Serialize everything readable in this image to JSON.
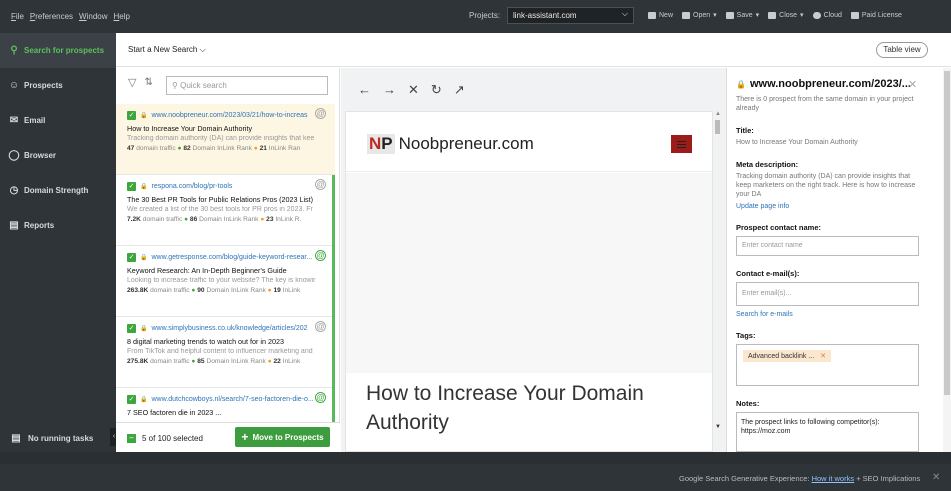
{
  "menubar": {
    "items": [
      "File",
      "Preferences",
      "Window",
      "Help"
    ],
    "accel": [
      "F",
      "P",
      "W",
      "H"
    ]
  },
  "projects": {
    "label": "Projects:",
    "selected": "link-assistant.com"
  },
  "toolbar": {
    "new": "New",
    "open": "Open",
    "save": "Save",
    "close": "Close",
    "cloud": "Cloud",
    "license": "Paid License"
  },
  "sidebar": {
    "items": [
      {
        "label": "Search for prospects",
        "icon": "search-icon"
      },
      {
        "label": "Prospects",
        "icon": "person-icon"
      },
      {
        "label": "Email",
        "icon": "mail-icon"
      },
      {
        "label": "Browser",
        "icon": "globe-icon"
      },
      {
        "label": "Domain Strength",
        "icon": "gauge-icon"
      },
      {
        "label": "Reports",
        "icon": "report-icon"
      }
    ],
    "running_tasks": "No running tasks"
  },
  "main": {
    "start_new_search": "Start a New Search",
    "table_view": "Table view"
  },
  "list": {
    "quick_search_placeholder": "Quick search",
    "cards": [
      {
        "url": "www.noobpreneur.com/2023/03/21/how-to-increas",
        "title": "How to Increase Your Domain Authority",
        "desc": "Tracking domain authority (DA) can provide insights that kee",
        "traffic": "47",
        "traffic_label": "domain traffic",
        "da": "82",
        "da_label": "Domain InLink Rank",
        "ilr": "21",
        "ilr_label": "InLink Ran"
      },
      {
        "url": "respona.com/blog/pr-tools",
        "title": "The 30 Best PR Tools for Public Relations Pros (2023 List)",
        "desc": "We created a list of the 30 best tools for PR pros in 2023. Fr",
        "traffic": "7.2K",
        "traffic_label": "domain traffic",
        "da": "86",
        "da_label": "Domain InLink Rank",
        "ilr": "23",
        "ilr_label": "InLink R."
      },
      {
        "url": "www.getresponse.com/blog/guide-keyword-resear...",
        "title": "Keyword Research: An In-Depth Beginner's Guide",
        "desc": "Looking to increase traffic to your website? The key is knowir",
        "traffic": "263.8K",
        "traffic_label": "domain traffic",
        "da": "90",
        "da_label": "Domain InLink Rank",
        "ilr": "19",
        "ilr_label": "InLink"
      },
      {
        "url": "www.simplybusiness.co.uk/knowledge/articles/202",
        "title": "8 digital marketing trends to watch out for in 2023",
        "desc": "From TikTok and helpful content to influencer marketing and",
        "traffic": "275.8K",
        "traffic_label": "domain traffic",
        "da": "85",
        "da_label": "Domain InLink Rank",
        "ilr": "22",
        "ilr_label": "InLink"
      },
      {
        "url": "www.dutchcowboys.nl/search/7-seo-factoren-die-o...",
        "title": "7 SEO factoren die in 2023 ...",
        "desc": "",
        "traffic": "",
        "traffic_label": "",
        "da": "",
        "da_label": "",
        "ilr": "",
        "ilr_label": ""
      }
    ],
    "selected_count": "5 of 100 selected",
    "move_button": "Move to Prospects"
  },
  "browser": {
    "logo_np_n": "N",
    "logo_np_p": "P",
    "logo_text": "Noobpreneur.com",
    "article_title": "How to Increase Your Domain Authority"
  },
  "details": {
    "domain": "www.noobpreneur.com/2023/...",
    "same_domain_note": "There is 0 prospect from the same domain in your project already",
    "title_label": "Title:",
    "title_value": "How to Increase Your Domain Authority",
    "meta_label": "Meta description:",
    "meta_value": "Tracking domain authority (DA) can provide insights that keep marketers on the right track. Here is how to increase your DA",
    "update_link": "Update page info",
    "contact_name_label": "Prospect contact name:",
    "contact_name_placeholder": "Enter contact name",
    "email_label": "Contact e-mail(s):",
    "email_placeholder": "Enter email(s)...",
    "search_emails_link": "Search for e-mails",
    "tags_label": "Tags:",
    "tags": [
      "Advanced backlink ..."
    ],
    "notes_label": "Notes:",
    "notes_value": "The prospect links to following competitor(s): https://moz.com"
  },
  "status": {
    "text": "Google Search Generative Experience:",
    "link": "How it works",
    "tail": "+ SEO Implications"
  },
  "colors": {
    "accent_green": "#3da63d",
    "sidebar_bg": "#2f3438",
    "link_blue": "#2c74b8",
    "logo_red": "#c0271e"
  }
}
